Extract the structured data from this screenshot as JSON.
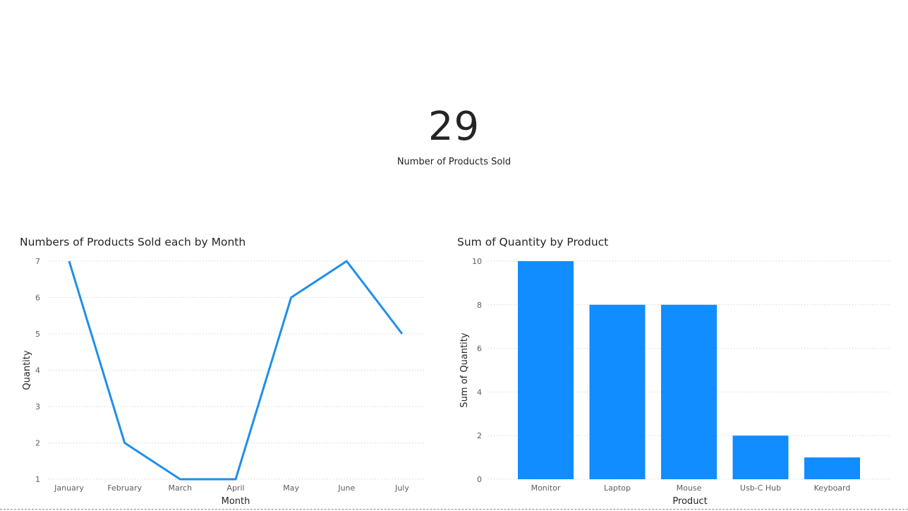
{
  "kpi": {
    "value": "29",
    "label": "Number of Products Sold"
  },
  "colors": {
    "series": "#118DFF",
    "line": "#1E8FEA",
    "grid": "#C8C6C4",
    "text": "#605E5C",
    "title": "#252423"
  },
  "chart_data": [
    {
      "type": "line",
      "title": "Numbers of Products Sold each by Month",
      "xlabel": "Month",
      "ylabel": "Quantity",
      "categories": [
        "January",
        "February",
        "March",
        "April",
        "May",
        "June",
        "July"
      ],
      "values": [
        7,
        2,
        1,
        1,
        6,
        7,
        5
      ],
      "ylim": [
        1,
        7
      ],
      "yticks": [
        1,
        2,
        3,
        4,
        5,
        6,
        7
      ],
      "grid": true
    },
    {
      "type": "bar",
      "title": "Sum of Quantity by Product",
      "xlabel": "Product",
      "ylabel": "Sum of Quantity",
      "categories": [
        "Monitor",
        "Laptop",
        "Mouse",
        "Usb-C Hub",
        "Keyboard"
      ],
      "values": [
        10,
        8,
        8,
        2,
        1
      ],
      "ylim": [
        0,
        10
      ],
      "yticks": [
        0,
        2,
        4,
        6,
        8,
        10
      ],
      "grid": true
    }
  ]
}
